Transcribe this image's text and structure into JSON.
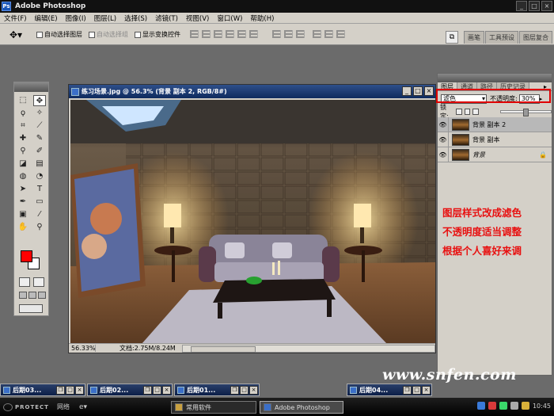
{
  "app": {
    "title": "Adobe Photoshop",
    "icon": "photoshop-icon"
  },
  "window_controls": {
    "minimize": "_",
    "maximize": "□",
    "close": "×"
  },
  "menu": [
    "文件(F)",
    "编辑(E)",
    "图像(I)",
    "图层(L)",
    "选择(S)",
    "滤镜(T)",
    "视图(V)",
    "窗口(W)",
    "帮助(H)"
  ],
  "options_bar": {
    "tool_icon": "move-tool-icon",
    "auto_select_layer": "自动选择图层",
    "auto_select_group": "自动选择组",
    "show_transform": "显示变换控件",
    "palette_tabs": [
      "画笔",
      "工具预设",
      "图层复合"
    ]
  },
  "document": {
    "title": "练习场景.jpg @ 56.3% (背景 副本 2, RGB/8#)",
    "zoom": "56.33%",
    "doc_info": "文档:2.75M/8.24M"
  },
  "layers_panel": {
    "tabs": [
      "图层",
      "通道",
      "路径",
      "历史记录"
    ],
    "blend_mode": "滤色",
    "opacity_label": "不透明度:",
    "opacity_value": "30%",
    "lock_label": "锁定:",
    "layers": [
      {
        "name": "背景 副本 2",
        "active": true,
        "italic": false
      },
      {
        "name": "背景 副本",
        "active": false,
        "italic": false
      },
      {
        "name": "背景",
        "active": false,
        "italic": true,
        "locked": true
      }
    ],
    "annotation": [
      "图层样式改成滤色",
      "不透明度适当调整",
      "根据个人喜好来调"
    ],
    "annotation_color": "#e81010"
  },
  "watermark": "www.snfen.com",
  "minimized_windows": [
    "后期03...",
    "后期02...",
    "后期01...",
    "后期04..."
  ],
  "taskbar": {
    "brand": "PROTECT",
    "network": "网络",
    "buttons": [
      "常用软件",
      "Adobe Photoshop"
    ],
    "time": "10:45"
  },
  "colors": {
    "foreground": "#ff0000",
    "background": "#ffffff",
    "highlight_box": "#e00000"
  }
}
